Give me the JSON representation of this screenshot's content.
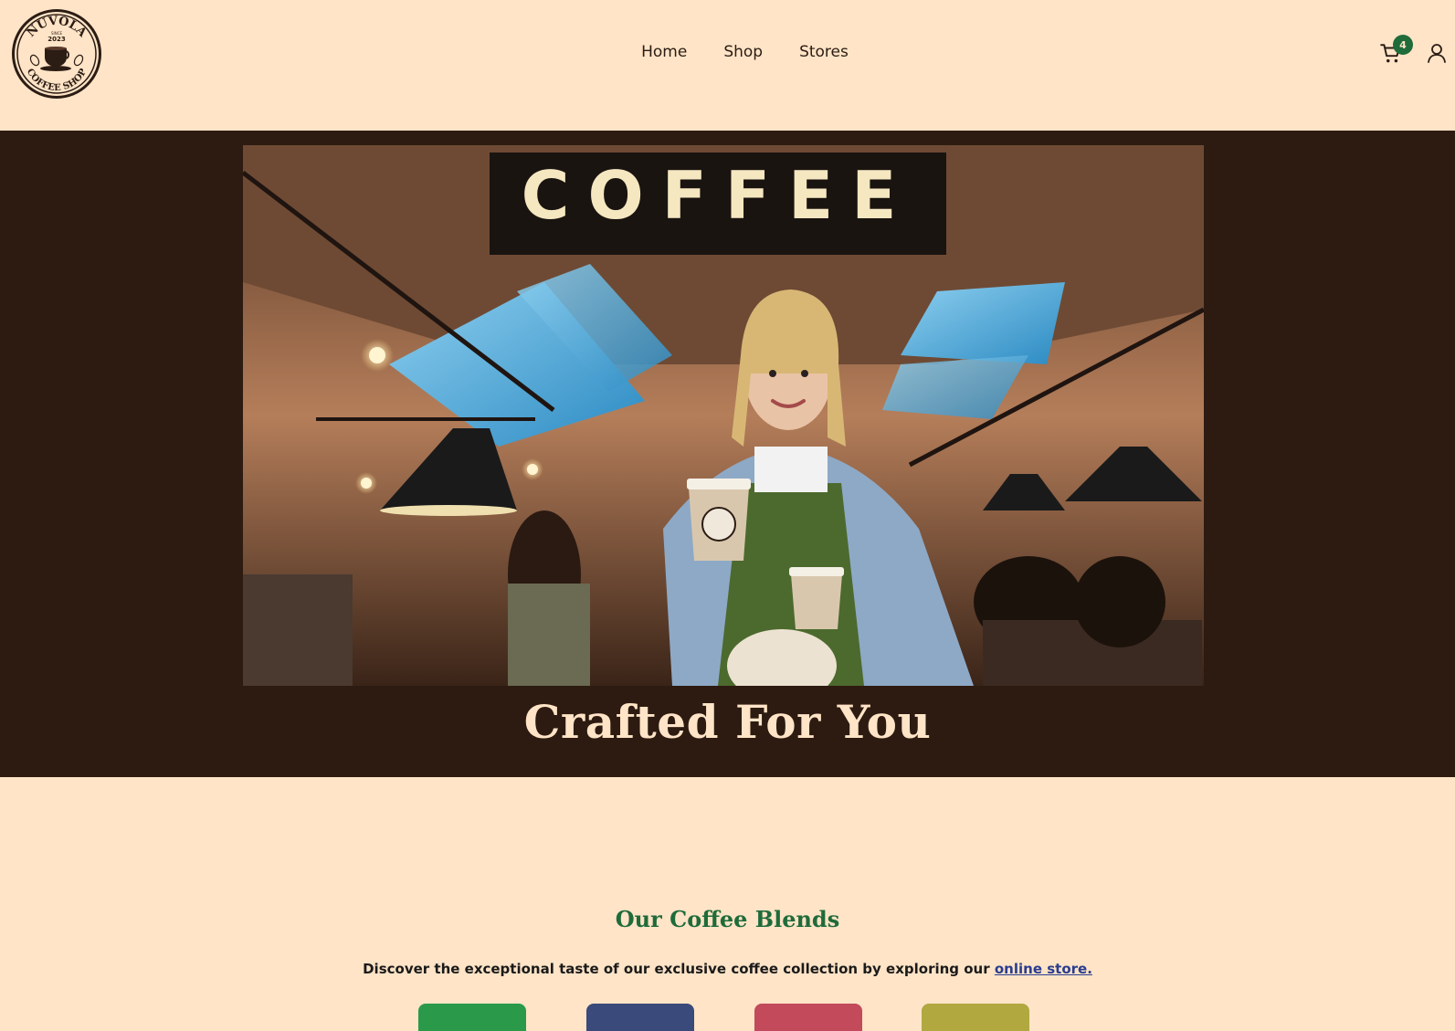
{
  "logo": {
    "top_text": "NUVOLA",
    "since": "SINCE",
    "year": "2023",
    "bottom_text": "COFFEE SHOP"
  },
  "nav": {
    "items": [
      {
        "label": "Home"
      },
      {
        "label": "Shop"
      },
      {
        "label": "Stores"
      }
    ]
  },
  "cart": {
    "count": "4"
  },
  "hero": {
    "sign_text": "COFFEE",
    "title": "Crafted For You"
  },
  "blends": {
    "title": "Our Coffee Blends",
    "description": "Discover the exceptional taste of our exclusive coffee collection by exploring our",
    "link_text": "online store.",
    "tiles": [
      {
        "color": "#2a9a4a"
      },
      {
        "color": "#3a4a7a"
      },
      {
        "color": "#c24a5a"
      },
      {
        "color": "#b2a840"
      }
    ]
  },
  "colors": {
    "background": "#ffe4c7",
    "hero_background": "#2d1b11",
    "accent_green": "#1f6b3a",
    "link_blue": "#2a3d8f"
  }
}
